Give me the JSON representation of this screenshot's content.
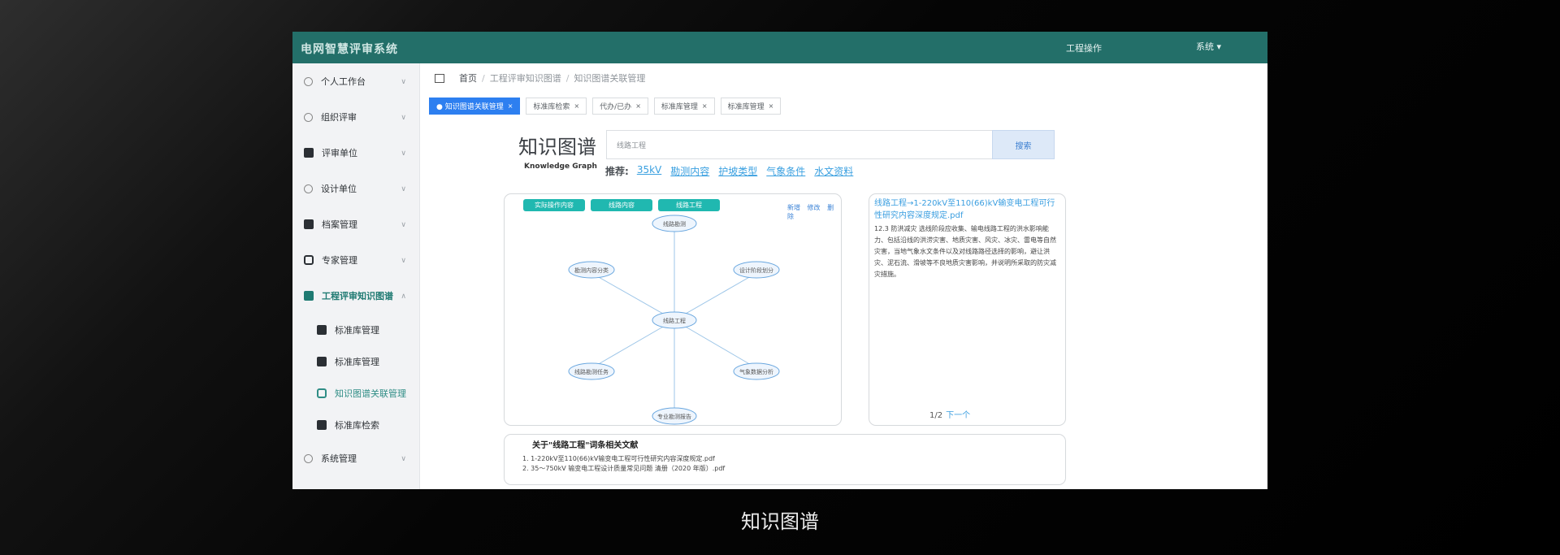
{
  "header": {
    "app_title": "电网智慧评审系统",
    "top_link": "工程操作",
    "user": "系统 ▾"
  },
  "sidebar": {
    "items": [
      {
        "label": "个人工作台"
      },
      {
        "label": "组织评审"
      },
      {
        "label": "评审单位"
      },
      {
        "label": "设计单位"
      },
      {
        "label": "档案管理"
      },
      {
        "label": "专家管理"
      },
      {
        "label": "工程评审知识图谱"
      },
      {
        "label": "标准库管理"
      },
      {
        "label": "标准库管理"
      },
      {
        "label": "知识图谱关联管理"
      },
      {
        "label": "标准库检索"
      },
      {
        "label": "系统管理"
      }
    ]
  },
  "breadcrumb": {
    "home": "首页",
    "level1": "工程评审知识图谱",
    "level2": "知识图谱关联管理"
  },
  "tabs": [
    {
      "label": "● 知识图谱关联管理"
    },
    {
      "label": "标准库检索"
    },
    {
      "label": "代办/已办"
    },
    {
      "label": "标准库管理"
    },
    {
      "label": "标准库管理"
    }
  ],
  "main": {
    "title": "知识图谱",
    "subtitle": "Knowledge Graph",
    "search_value": "线路工程",
    "search_button": "搜索",
    "recommend_label": "推荐:",
    "recommend": [
      "35kV",
      "勘测内容",
      "护坡类型",
      "气象条件",
      "水文资料"
    ]
  },
  "graph": {
    "pills": [
      "实际操作内容",
      "线路内容",
      "线路工程"
    ],
    "actions": [
      "新增",
      "修改",
      "删除"
    ],
    "center": "线路工程",
    "nodes": [
      "线路勘测",
      "勘测内容分类",
      "设计阶段划分",
      "线路勘测任务",
      "气象数据分析",
      "专业勘测报告"
    ]
  },
  "doc": {
    "title": "线路工程→1-220kV至110(66)kV输变电工程可行性研究内容深度规定.pdf",
    "body": "12.3 防洪减灾 选线阶段应收集、输电线路工程的洪水影响能力、包括沿线的洪涝灾害、地质灾害、风灾、冰灾、雷电等自然灾害，当地气象水文条件以及对线路路径选择的影响，避让洪灾、泥石流、滑坡等不良地质灾害影响，并说明所采取的防灾减灾措施。",
    "page": "1/2",
    "next": "下一个"
  },
  "literature": {
    "title": "关于\"线路工程\"词条相关文献",
    "items": [
      "1. 1-220kV至110(66)kV输变电工程可行性研究内容深度规定.pdf",
      "2. 35～750kV 输变电工程设计质量常见问题 清册（2020 年版）.pdf"
    ]
  },
  "caption": "知识图谱",
  "colors": {
    "header_bg": "#236f69",
    "accent_teal": "#20b8b0",
    "tab_active": "#2d7ff0",
    "link": "#3aa0e0"
  }
}
